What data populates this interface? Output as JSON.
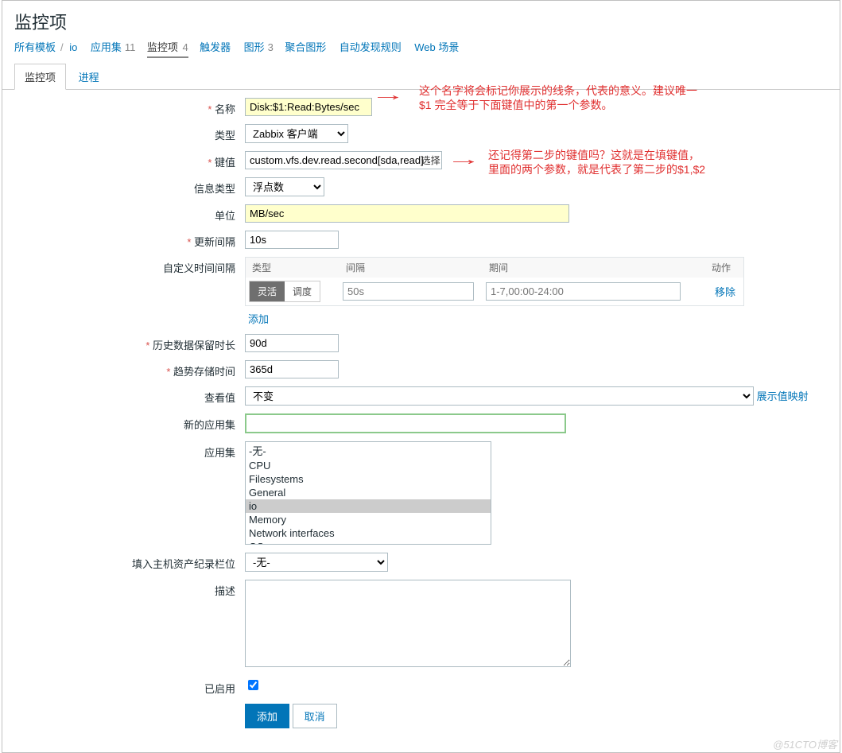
{
  "page": {
    "title": "监控项"
  },
  "breadcrumb": {
    "items": [
      {
        "label": "所有模板",
        "count": ""
      },
      {
        "label": "io",
        "count": ""
      },
      {
        "label": "应用集",
        "count": "11"
      },
      {
        "label": "监控项",
        "count": "4",
        "active": true
      },
      {
        "label": "触发器",
        "count": ""
      },
      {
        "label": "图形",
        "count": "3"
      },
      {
        "label": "聚合图形",
        "count": ""
      },
      {
        "label": "自动发现规则",
        "count": ""
      },
      {
        "label": "Web 场景",
        "count": ""
      }
    ]
  },
  "tabs": {
    "item": "监控项",
    "process": "进程"
  },
  "form": {
    "name_label": "名称",
    "name": "Disk:$1:Read:Bytes/sec",
    "type_label": "类型",
    "type": "Zabbix 客户端",
    "key_label": "键值",
    "key": "custom.vfs.dev.read.second[sda,read]",
    "key_select": "选择",
    "infotype_label": "信息类型",
    "infotype": "浮点数",
    "unit_label": "单位",
    "unit": "MB/sec",
    "interval_label": "更新间隔",
    "interval": "10s",
    "custom_label": "自定义时间间隔",
    "custom_head": {
      "type": "类型",
      "gap": "间隔",
      "period": "期间",
      "action": "动作"
    },
    "seg_on": "灵活",
    "seg_off": "调度",
    "gap_ph": "50s",
    "period_ph": "1-7,00:00-24:00",
    "remove": "移除",
    "add": "添加",
    "history_label": "历史数据保留时长",
    "history": "90d",
    "trend_label": "趋势存储时间",
    "trend": "365d",
    "show_label": "查看值",
    "show": "不变",
    "showmap": "展示值映射",
    "newapp_label": "新的应用集",
    "newapp": "",
    "app_label": "应用集",
    "apps": [
      "-无-",
      "CPU",
      "Filesystems",
      "General",
      "io",
      "Memory",
      "Network interfaces",
      "OS"
    ],
    "app_selected": "io",
    "inv_label": "填入主机资产纪录栏位",
    "inv": "-无-",
    "desc_label": "描述",
    "desc": "",
    "enabled_label": "已启用",
    "btn_add": "添加",
    "btn_cancel": "取消"
  },
  "annotations": {
    "a1l1": "这个名字将会标记你展示的线条，代表的意义。建议唯一",
    "a1l2": "$1 完全等于下面键值中的第一个参数。",
    "a2l1": "还记得第二步的键值吗？这就是在填键值，",
    "a2l2": "里面的两个参数，就是代表了第二步的$1,$2"
  },
  "watermark": "@51CTO博客"
}
